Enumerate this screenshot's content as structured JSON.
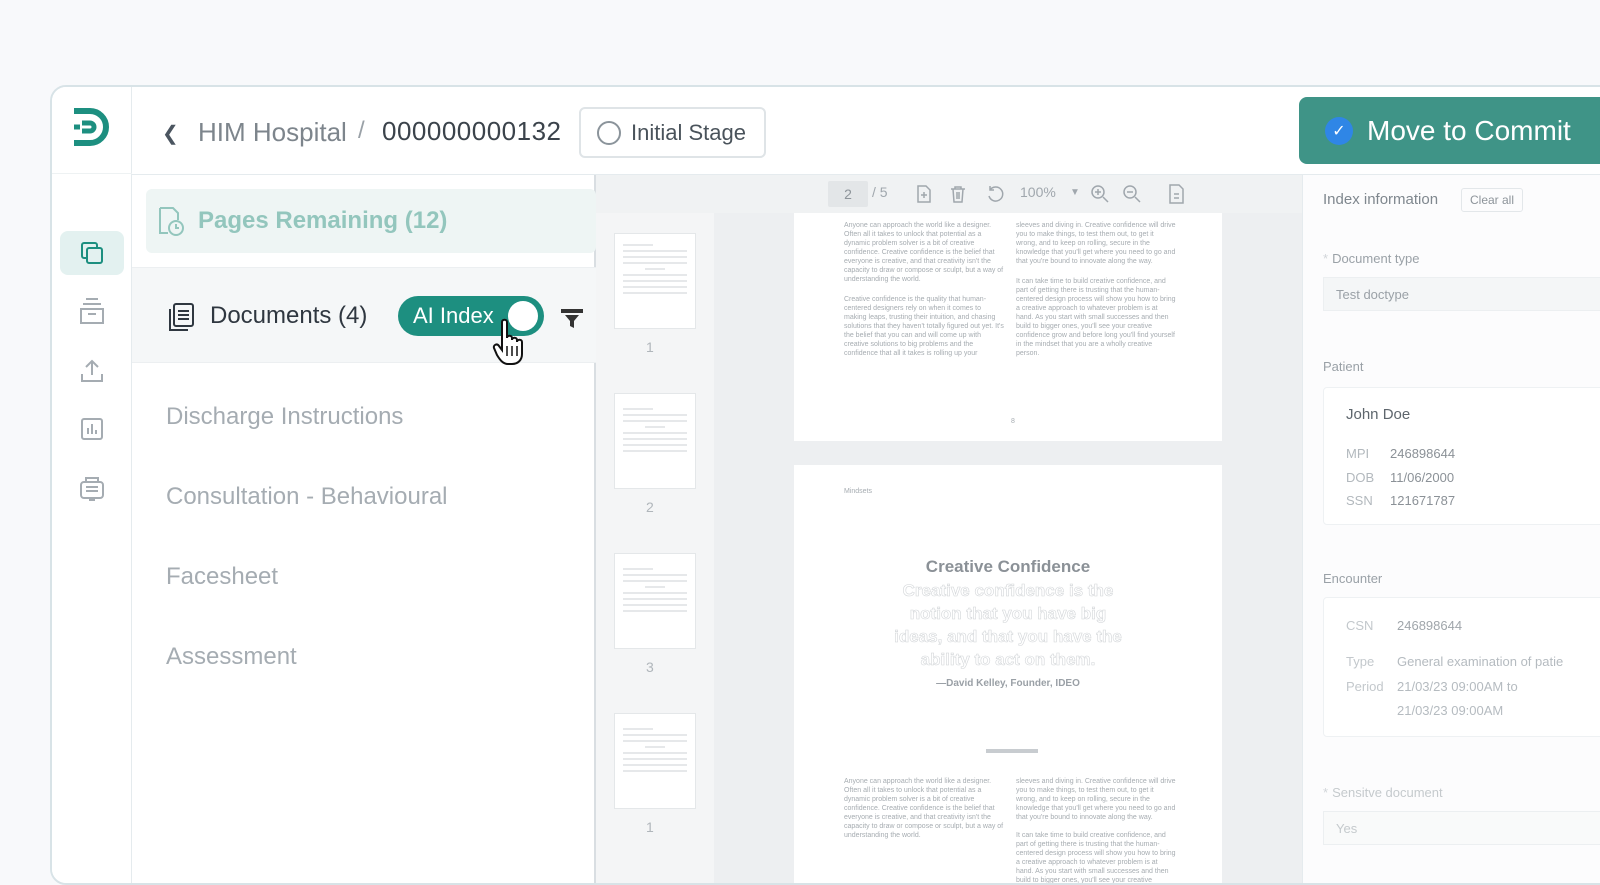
{
  "header": {
    "breadcrumb_parent": "HIM Hospital",
    "breadcrumb_sep": "/",
    "breadcrumb_current": "000000000132",
    "stage_label": "Initial Stage",
    "commit_label": "Move to Commit"
  },
  "docs_panel": {
    "pages_remaining": "Pages Remaining (12)",
    "documents_title": "Documents (4)",
    "ai_index_label": "AI Index",
    "items": [
      "Discharge Instructions",
      "Consultation - Behavioural",
      "Facesheet",
      "Assessment"
    ]
  },
  "viewer": {
    "page_input": "2",
    "page_total": "/ 5",
    "zoom": "100%",
    "thumb_numbers": [
      "1",
      "2",
      "3",
      "1"
    ],
    "page_header_label": "Mindsets",
    "quote_title": "Creative Confidence",
    "quote_text": "Creative confidence is the notion that you have big ideas, and that you have the ability to act on them.",
    "quote_author": "—David Kelley, Founder, IDEO",
    "body_col1": "Anyone can approach the world like a designer. Often all it takes to unlock that potential as a dynamic problem solver is a bit of creative confidence. Creative confidence is the belief that everyone is creative, and that creativity isn't the capacity to draw or compose or sculpt, but a way of understanding the world.",
    "body_col1b": "Creative confidence is the quality that human-centered designers rely on when it comes to making leaps, trusting their intuition, and chasing solutions that they haven't totally figured out yet. It's the belief that you can and will come up with creative solutions to big problems and the confidence that all it takes is rolling up your",
    "body_col2": "sleeves and diving in. Creative confidence will drive you to make things, to test them out, to get it wrong, and to keep on rolling, secure in the knowledge that you'll get where you need to go and that you're bound to innovate along the way.",
    "body_col2b": "It can take time to build creative confidence, and part of getting there is trusting that the human-centered design process will show you how to bring a creative approach to whatever problem is at hand. As you start with small successes and then build to bigger ones, you'll see your creative confidence grow and before long you'll find yourself in the mindset that you are a wholly creative person.",
    "page_footer": "8"
  },
  "index_panel": {
    "title": "Index information",
    "clear_all": "Clear all",
    "doc_type_label": "Document type",
    "doc_type_value": "Test doctype",
    "patient_label": "Patient",
    "patient_name": "John Doe",
    "mpi_label": "MPI",
    "mpi_value": "246898644",
    "dob_label": "DOB",
    "dob_value": "11/06/2000",
    "ssn_label": "SSN",
    "ssn_value": "121671787",
    "encounter_label": "Encounter",
    "csn_label": "CSN",
    "csn_value": "246898644",
    "type_label": "Type",
    "type_value": "General examination of patie",
    "period_label": "Period",
    "period_value_1": "21/03/23 09:00AM to",
    "period_value_2": "21/03/23 09:00AM",
    "sensitive_label": "Sensitve document",
    "sensitive_value": "Yes"
  },
  "colors": {
    "brand": "#1d8f80",
    "commit_bg": "#3f9487",
    "check_blue": "#2f86e6"
  }
}
